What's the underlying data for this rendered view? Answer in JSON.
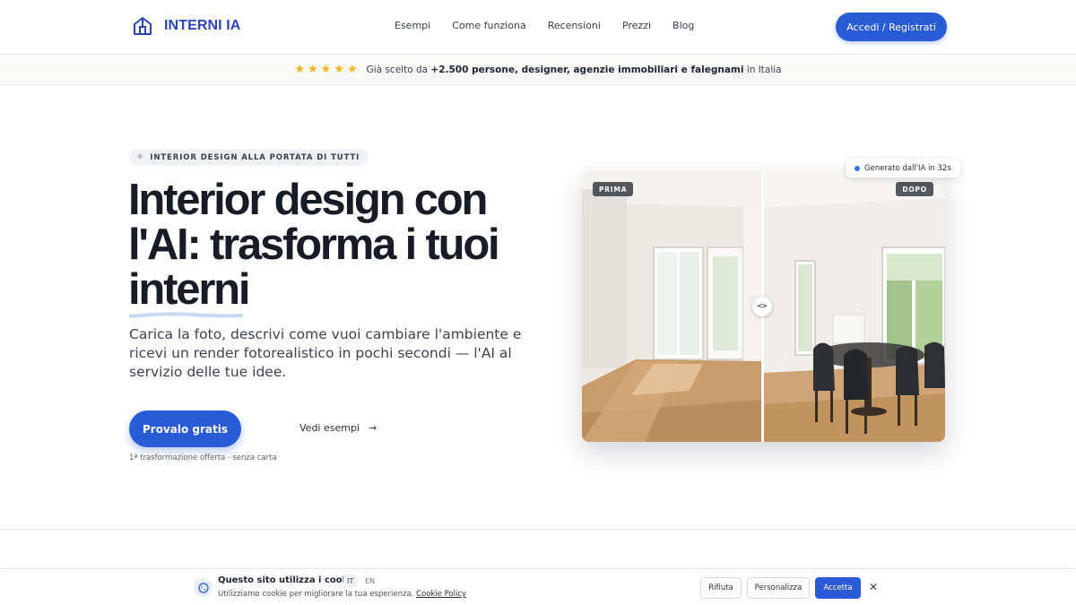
{
  "brand": {
    "name": "INTERNI IA",
    "icon": "house-icon",
    "color": "#2b44b8"
  },
  "nav": {
    "items": [
      "Esempi",
      "Come funziona",
      "Recensioni",
      "Prezzi",
      "Blog"
    ],
    "login_label": "Accedi / Registrati"
  },
  "trust": {
    "rating": 5,
    "text_prefix": "Già scelto da ",
    "text_bold": "+2.500 persone, designer, agenzie immobiliari e falegnami",
    "text_suffix": " in Italia"
  },
  "hero": {
    "pill": "INTERIOR DESIGN ALLA PORTATA DI TUTTI",
    "title_main": "Interior design con l'AI: trasforma i tuoi ",
    "title_highlight": "interni",
    "subtitle": "Carica la foto, descrivi come vuoi cambiare l'ambiente e ricevi un render fotorealistico in pochi secondi — l'AI al servizio delle tue idee.",
    "cta_label": "Provalo gratis",
    "secondary_label": "Vedi esempi",
    "note": "1ª trasformazione offerta · senza carta"
  },
  "compare": {
    "before_label": "PRIMA",
    "after_label": "DOPO",
    "badge": "Generato dall'IA in 32s"
  },
  "cookie": {
    "title": "Questo sito utilizza i cookie",
    "lang_active": "IT",
    "lang_other": "EN",
    "description": "Utilizziamo cookie per migliorare la tua esperienza. ",
    "policy_link": "Cookie Policy",
    "reject_label": "Rifiuta",
    "customize_label": "Personalizza",
    "accept_label": "Accetta"
  },
  "colors": {
    "primary": "#2a5bd7",
    "star": "#f5b51c"
  }
}
